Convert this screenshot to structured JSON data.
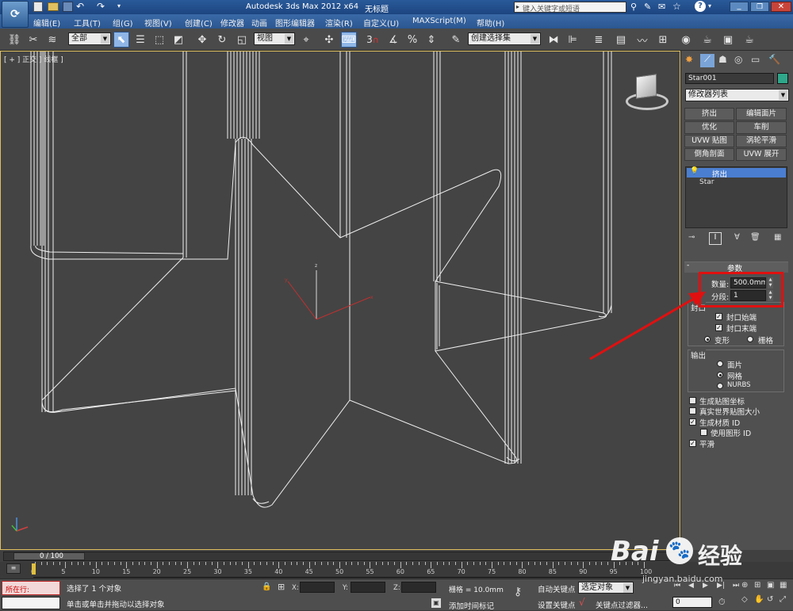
{
  "title_bar": {
    "app_title": "Autodesk 3ds Max  2012 x64",
    "doc_title": "无标题",
    "search_placeholder": "键入关键字或短语"
  },
  "menu": {
    "items": [
      "编辑(E)",
      "工具(T)",
      "组(G)",
      "视图(V)",
      "创建(C)",
      "修改器",
      "动画",
      "图形编辑器",
      "渲染(R)",
      "自定义(U)",
      "MAXScript(M)",
      "帮助(H)"
    ]
  },
  "toolbar": {
    "selection_filter": "全部",
    "reference_coord": "视图",
    "snap_label": "3",
    "named_selection": "创建选择集"
  },
  "viewport": {
    "label": "[ + ] 正交 ] 线框 ]"
  },
  "command_panel": {
    "object_name": "Star001",
    "modifier_list": "修改器列表",
    "modifier_buttons": [
      "挤出",
      "编辑面片",
      "优化",
      "车削",
      "UVW 贴图",
      "涡轮平滑",
      "倒角剖面",
      "UVW 展开"
    ],
    "stack": [
      "挤出",
      "Star"
    ],
    "rollout_title": "参数",
    "amount_label": "数量:",
    "amount_value": "500.0mm",
    "segments_label": "分段:",
    "segments_value": "1",
    "capping_group": "封口",
    "cap_start": "封口始端",
    "cap_end": "封口末端",
    "morph": "变形",
    "grid": "栅格",
    "output_group": "输出",
    "out_patch": "面片",
    "out_mesh": "网格",
    "out_nurbs": "NURBS",
    "gen_map_coords": "生成贴图坐标",
    "real_world_map": "真实世界贴图大小",
    "gen_mat_ids": "生成材质 ID",
    "use_shape_ids": "使用图形 ID",
    "smooth": "平滑"
  },
  "timeline": {
    "frame_display": "0 / 100",
    "ruler_ticks": [
      "0",
      "5",
      "10",
      "15",
      "20",
      "25",
      "30",
      "35",
      "40",
      "45",
      "50",
      "55",
      "60",
      "65",
      "70",
      "75",
      "80",
      "85",
      "90",
      "95",
      "100"
    ]
  },
  "status": {
    "script_label": "所在行:",
    "selected": "选择了 1 个对象",
    "prompt": "单击或单击并拖动以选择对象",
    "x_label": "X:",
    "y_label": "Y:",
    "z_label": "Z:",
    "grid_info": "栅格 = 10.0mm",
    "add_time_tag": "添加时间标记",
    "auto_key": "自动关键点",
    "selected_dropdown": "选定对象",
    "set_key": "设置关键点",
    "key_filters": "关键点过滤器...",
    "frame_field": "0"
  },
  "watermark": {
    "brand": "Bai",
    "brand2": "经验",
    "url": "jingyan.baidu.com"
  },
  "colors": {
    "highlight_red": "#e01010",
    "object_color": "#2fa78a",
    "viewport_border": "#e0c060"
  }
}
